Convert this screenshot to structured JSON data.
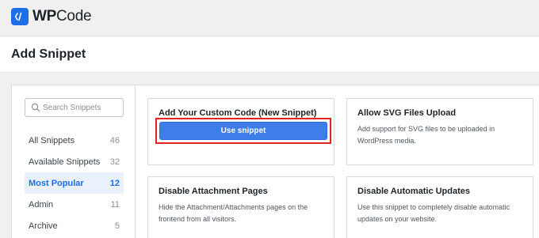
{
  "brand": {
    "name_bold": "WP",
    "name_light": "Code"
  },
  "page": {
    "title": "Add Snippet"
  },
  "search": {
    "placeholder": "Search Snippets",
    "value": ""
  },
  "sidebar": {
    "items": [
      {
        "label": "All Snippets",
        "count": "46",
        "active": false
      },
      {
        "label": "Available Snippets",
        "count": "32",
        "active": false
      },
      {
        "label": "Most Popular",
        "count": "12",
        "active": true
      },
      {
        "label": "Admin",
        "count": "11",
        "active": false
      },
      {
        "label": "Archive",
        "count": "5",
        "active": false
      }
    ]
  },
  "cards": [
    {
      "title": "Add Your Custom Code (New Snippet)",
      "button_label": "Use snippet"
    },
    {
      "title": "Allow SVG Files Upload",
      "description": "Add support for SVG files to be uploaded in WordPress media."
    },
    {
      "title": "Disable Attachment Pages",
      "description": "Hide the Attachment/Attachments pages on the frontend from all visitors."
    },
    {
      "title": "Disable Automatic Updates",
      "description": "Use this snippet to completely disable automatic updates on your website."
    }
  ],
  "colors": {
    "brand": "#1d6fe8",
    "button": "#3f7ee8",
    "highlight_border": "#e02424",
    "active_bg": "#eaf1fc"
  }
}
